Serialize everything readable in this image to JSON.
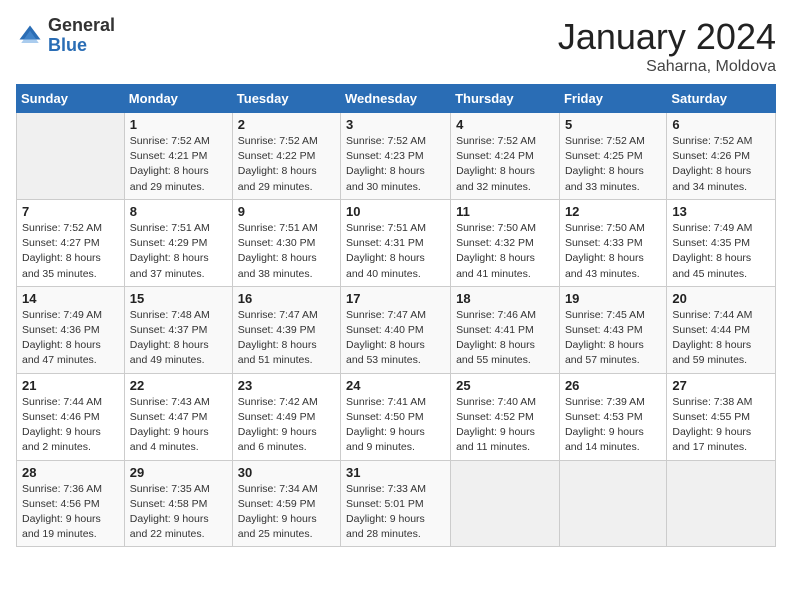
{
  "header": {
    "logo_general": "General",
    "logo_blue": "Blue",
    "month": "January 2024",
    "location": "Saharna, Moldova"
  },
  "days_of_week": [
    "Sunday",
    "Monday",
    "Tuesday",
    "Wednesday",
    "Thursday",
    "Friday",
    "Saturday"
  ],
  "weeks": [
    [
      {
        "day": "",
        "info": ""
      },
      {
        "day": "1",
        "info": "Sunrise: 7:52 AM\nSunset: 4:21 PM\nDaylight: 8 hours\nand 29 minutes."
      },
      {
        "day": "2",
        "info": "Sunrise: 7:52 AM\nSunset: 4:22 PM\nDaylight: 8 hours\nand 29 minutes."
      },
      {
        "day": "3",
        "info": "Sunrise: 7:52 AM\nSunset: 4:23 PM\nDaylight: 8 hours\nand 30 minutes."
      },
      {
        "day": "4",
        "info": "Sunrise: 7:52 AM\nSunset: 4:24 PM\nDaylight: 8 hours\nand 32 minutes."
      },
      {
        "day": "5",
        "info": "Sunrise: 7:52 AM\nSunset: 4:25 PM\nDaylight: 8 hours\nand 33 minutes."
      },
      {
        "day": "6",
        "info": "Sunrise: 7:52 AM\nSunset: 4:26 PM\nDaylight: 8 hours\nand 34 minutes."
      }
    ],
    [
      {
        "day": "7",
        "info": "Sunrise: 7:52 AM\nSunset: 4:27 PM\nDaylight: 8 hours\nand 35 minutes."
      },
      {
        "day": "8",
        "info": "Sunrise: 7:51 AM\nSunset: 4:29 PM\nDaylight: 8 hours\nand 37 minutes."
      },
      {
        "day": "9",
        "info": "Sunrise: 7:51 AM\nSunset: 4:30 PM\nDaylight: 8 hours\nand 38 minutes."
      },
      {
        "day": "10",
        "info": "Sunrise: 7:51 AM\nSunset: 4:31 PM\nDaylight: 8 hours\nand 40 minutes."
      },
      {
        "day": "11",
        "info": "Sunrise: 7:50 AM\nSunset: 4:32 PM\nDaylight: 8 hours\nand 41 minutes."
      },
      {
        "day": "12",
        "info": "Sunrise: 7:50 AM\nSunset: 4:33 PM\nDaylight: 8 hours\nand 43 minutes."
      },
      {
        "day": "13",
        "info": "Sunrise: 7:49 AM\nSunset: 4:35 PM\nDaylight: 8 hours\nand 45 minutes."
      }
    ],
    [
      {
        "day": "14",
        "info": "Sunrise: 7:49 AM\nSunset: 4:36 PM\nDaylight: 8 hours\nand 47 minutes."
      },
      {
        "day": "15",
        "info": "Sunrise: 7:48 AM\nSunset: 4:37 PM\nDaylight: 8 hours\nand 49 minutes."
      },
      {
        "day": "16",
        "info": "Sunrise: 7:47 AM\nSunset: 4:39 PM\nDaylight: 8 hours\nand 51 minutes."
      },
      {
        "day": "17",
        "info": "Sunrise: 7:47 AM\nSunset: 4:40 PM\nDaylight: 8 hours\nand 53 minutes."
      },
      {
        "day": "18",
        "info": "Sunrise: 7:46 AM\nSunset: 4:41 PM\nDaylight: 8 hours\nand 55 minutes."
      },
      {
        "day": "19",
        "info": "Sunrise: 7:45 AM\nSunset: 4:43 PM\nDaylight: 8 hours\nand 57 minutes."
      },
      {
        "day": "20",
        "info": "Sunrise: 7:44 AM\nSunset: 4:44 PM\nDaylight: 8 hours\nand 59 minutes."
      }
    ],
    [
      {
        "day": "21",
        "info": "Sunrise: 7:44 AM\nSunset: 4:46 PM\nDaylight: 9 hours\nand 2 minutes."
      },
      {
        "day": "22",
        "info": "Sunrise: 7:43 AM\nSunset: 4:47 PM\nDaylight: 9 hours\nand 4 minutes."
      },
      {
        "day": "23",
        "info": "Sunrise: 7:42 AM\nSunset: 4:49 PM\nDaylight: 9 hours\nand 6 minutes."
      },
      {
        "day": "24",
        "info": "Sunrise: 7:41 AM\nSunset: 4:50 PM\nDaylight: 9 hours\nand 9 minutes."
      },
      {
        "day": "25",
        "info": "Sunrise: 7:40 AM\nSunset: 4:52 PM\nDaylight: 9 hours\nand 11 minutes."
      },
      {
        "day": "26",
        "info": "Sunrise: 7:39 AM\nSunset: 4:53 PM\nDaylight: 9 hours\nand 14 minutes."
      },
      {
        "day": "27",
        "info": "Sunrise: 7:38 AM\nSunset: 4:55 PM\nDaylight: 9 hours\nand 17 minutes."
      }
    ],
    [
      {
        "day": "28",
        "info": "Sunrise: 7:36 AM\nSunset: 4:56 PM\nDaylight: 9 hours\nand 19 minutes."
      },
      {
        "day": "29",
        "info": "Sunrise: 7:35 AM\nSunset: 4:58 PM\nDaylight: 9 hours\nand 22 minutes."
      },
      {
        "day": "30",
        "info": "Sunrise: 7:34 AM\nSunset: 4:59 PM\nDaylight: 9 hours\nand 25 minutes."
      },
      {
        "day": "31",
        "info": "Sunrise: 7:33 AM\nSunset: 5:01 PM\nDaylight: 9 hours\nand 28 minutes."
      },
      {
        "day": "",
        "info": ""
      },
      {
        "day": "",
        "info": ""
      },
      {
        "day": "",
        "info": ""
      }
    ]
  ]
}
